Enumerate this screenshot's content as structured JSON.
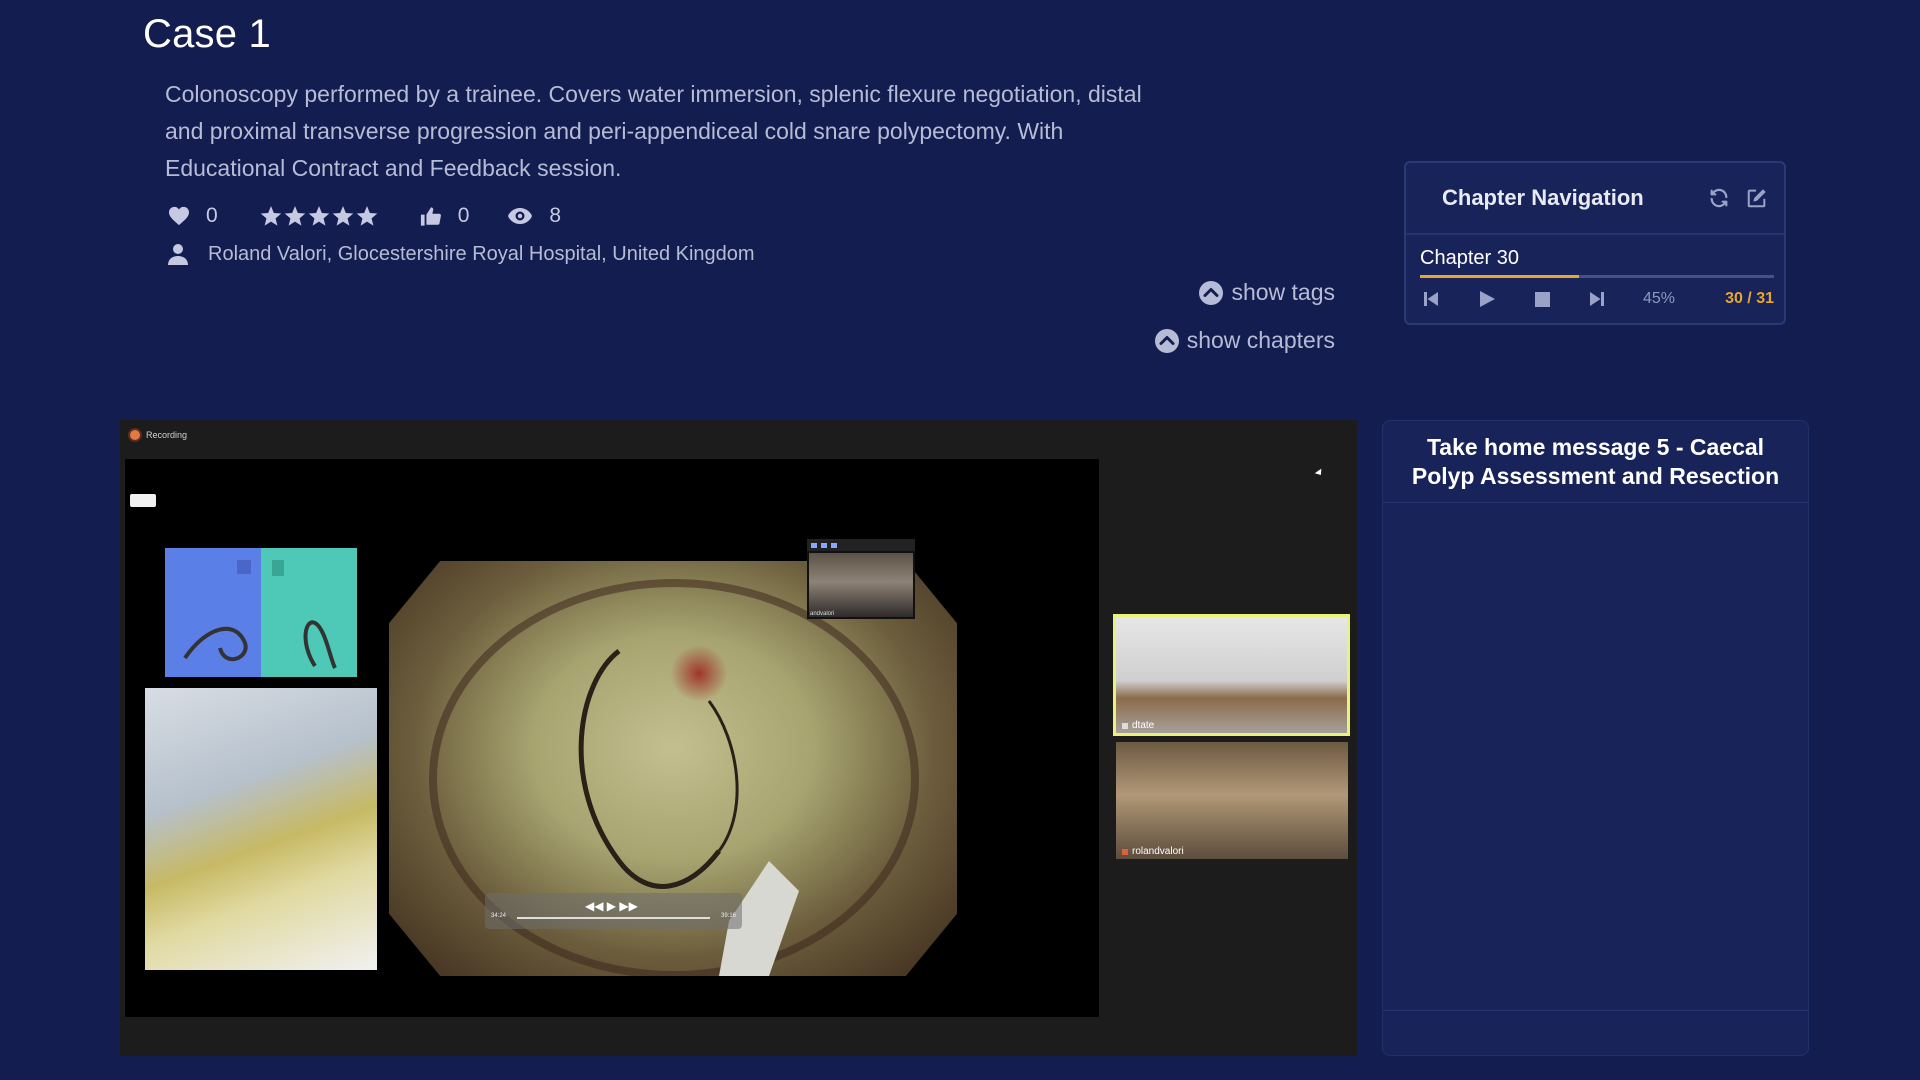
{
  "case": {
    "title": "Case 1",
    "description": "Colonoscopy performed by a trainee. Covers water immersion, splenic flexure negotiation, distal and proximal transverse progression and peri-appendiceal cold snare polypectomy. With Educational Contract and Feedback session."
  },
  "stats": {
    "likes": "0",
    "rating_stars": 5,
    "thumbs_up": "0",
    "views": "8"
  },
  "author": {
    "text": "Roland Valori, Glocestershire Royal Hospital, United Kingdom"
  },
  "toggles": {
    "tags_label": "show tags",
    "chapters_label": "show chapters"
  },
  "chapter_nav": {
    "title": "Chapter Navigation",
    "current_chapter": "Chapter 30",
    "progress_percent": "45%",
    "progress_fraction": 0.45,
    "count": "30 / 31"
  },
  "video": {
    "recording_label": "Recording",
    "participant_1": "dtate",
    "participant_2": "rolandvalori",
    "tooltip_label": "andvalori",
    "player_time_start": "34:24",
    "player_time_end": "39:16"
  },
  "take_home": {
    "title": "Take home message 5 - Caecal Polyp Assessment and Resection"
  },
  "colors": {
    "background": "#141d4f",
    "panel": "#182459",
    "accent": "#e5a632",
    "muted_text": "#b6bcd6",
    "active_tile_border": "#e9f37a"
  },
  "icons": {
    "likes": "heart-icon",
    "rating": "star-icon",
    "thumbs": "thumbs-up-icon",
    "views": "eye-icon",
    "author": "user-icon",
    "toggle": "chevron-up-circle-icon",
    "refresh": "refresh-icon",
    "edit": "edit-icon",
    "prev": "skip-back-icon",
    "play": "play-icon",
    "stop": "stop-icon",
    "next": "skip-forward-icon"
  }
}
